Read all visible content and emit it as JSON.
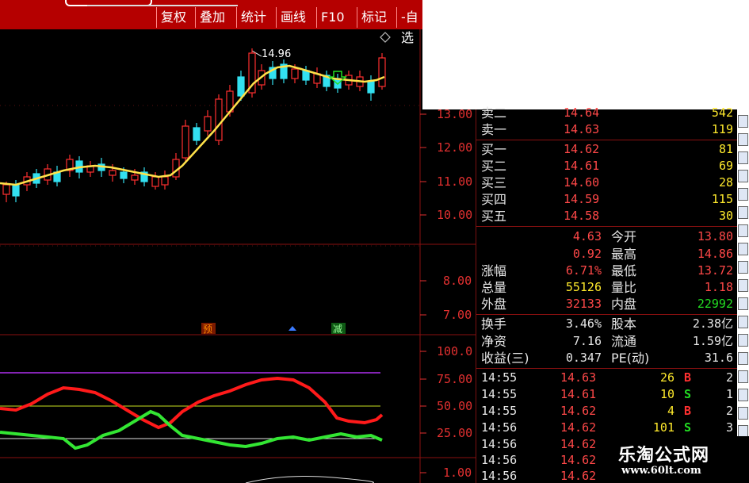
{
  "toolbar": {
    "buttons": [
      "复权",
      "叠加",
      "统计",
      "画线",
      "F10",
      "标记",
      "-自选"
    ]
  },
  "colors": {
    "up": "#ff3030",
    "down": "#33e0f0",
    "ma": "#ffe24a",
    "grid_red": "#8a1010",
    "kdj_red": "#ff1a1a",
    "kdj_green": "#33e633",
    "purple": "#b030f0"
  },
  "main_chart": {
    "high_label": "14.96",
    "price_axis": [
      "13.00",
      "12.00",
      "11.00",
      "10.00"
    ]
  },
  "volume_chart": {
    "axis": [
      "8.00",
      "7.00"
    ],
    "markers": [
      "预",
      "减"
    ]
  },
  "indicator_chart": {
    "axis": [
      "100.0",
      "75.00",
      "50.00",
      "25.00"
    ]
  },
  "sub_chart": {
    "axis": [
      "1.00"
    ]
  },
  "order_book": {
    "asks": [
      {
        "label": "卖二",
        "price": "14.64",
        "vol": "542"
      },
      {
        "label": "卖一",
        "price": "14.63",
        "vol": "119"
      }
    ],
    "bids": [
      {
        "label": "买一",
        "price": "14.62",
        "vol": "81"
      },
      {
        "label": "买二",
        "price": "14.61",
        "vol": "69"
      },
      {
        "label": "买三",
        "price": "14.60",
        "vol": "28"
      },
      {
        "label": "买四",
        "price": "14.59",
        "vol": "115"
      },
      {
        "label": "买五",
        "price": "14.58",
        "vol": "30"
      }
    ]
  },
  "stats": [
    {
      "l1": "",
      "v1": "4.63",
      "l2": "今开",
      "v2": "13.80"
    },
    {
      "l1": "",
      "v1": "0.92",
      "l2": "最高",
      "v2": "14.86"
    },
    {
      "l1": "涨幅",
      "v1": "6.71%",
      "l2": "最低",
      "v2": "13.72"
    },
    {
      "l1": "总量",
      "v1": "55126",
      "l2": "量比",
      "v2": "1.18"
    },
    {
      "l1": "外盘",
      "v1": "32133",
      "l2": "内盘",
      "v2": "22992"
    }
  ],
  "fundamentals": [
    {
      "l1": "换手",
      "v1": "3.46%",
      "l2": "股本",
      "v2": "2.38亿"
    },
    {
      "l1": "净资",
      "v1": "7.16",
      "l2": "流通",
      "v2": "1.59亿"
    },
    {
      "l1": "收益(三)",
      "v1": "0.347",
      "l2": "PE(动)",
      "v2": "31.6"
    }
  ],
  "ticks": [
    {
      "time": "14:55",
      "price": "14.63",
      "vol": "26",
      "side": "B",
      "n": "2"
    },
    {
      "time": "14:55",
      "price": "14.61",
      "vol": "10",
      "side": "S",
      "n": "1"
    },
    {
      "time": "14:55",
      "price": "14.62",
      "vol": "4",
      "side": "B",
      "n": "2"
    },
    {
      "time": "14:56",
      "price": "14.62",
      "vol": "101",
      "side": "S",
      "n": "3"
    },
    {
      "time": "14:56",
      "price": "14.62",
      "vol": "",
      "side": "",
      "n": ""
    },
    {
      "time": "14:56",
      "price": "14.62",
      "vol": "",
      "side": "",
      "n": ""
    },
    {
      "time": "14:56",
      "price": "14.62",
      "vol": "",
      "side": "",
      "n": ""
    }
  ],
  "watermark": {
    "name": "乐淘公式网",
    "url": "www.60lt.com"
  }
}
